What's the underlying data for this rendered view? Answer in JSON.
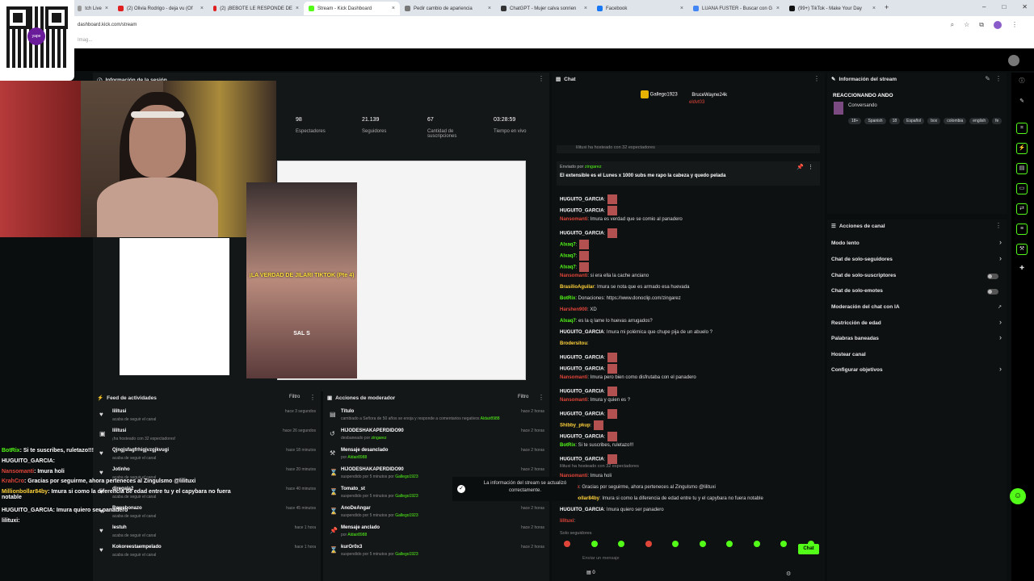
{
  "browser": {
    "tabs": [
      {
        "title": "tch Live",
        "icon_color": "#999999"
      },
      {
        "title": "(2) Olivia Rodrigo - deja vu (Of",
        "icon_color": "#e02020"
      },
      {
        "title": "(2) ¡BEBOTE LE RESPONDE DE",
        "icon_color": "#e02020"
      },
      {
        "title": "Stream - Kick Dashboard",
        "icon_color": "#53fc18"
      },
      {
        "title": "Pedir cambio de apariencia",
        "icon_color": "#777777"
      },
      {
        "title": "ChatGPT - Mujer calva sonrien",
        "icon_color": "#333333"
      },
      {
        "title": "Facebook",
        "icon_color": "#1877f2"
      },
      {
        "title": "LUANA FUSTER - Buscar con G",
        "icon_color": "#4285f4"
      },
      {
        "title": "(99+) TikTok - Make Your Day",
        "icon_color": "#111111"
      }
    ],
    "new_tab": "+",
    "window_controls": [
      "–",
      "□",
      "✕"
    ],
    "url": "dashboard.kick.com/stream",
    "bookmark_text": "Imag..."
  },
  "qr": {
    "logo_text": "yape"
  },
  "session": {
    "title": "Información de la sesión",
    "stats": [
      {
        "value": "98",
        "label": "Espectadores"
      },
      {
        "value": "21.139",
        "label": "Seguidores"
      },
      {
        "value": "67",
        "label": "Cantidad de suscripciones"
      },
      {
        "value": "03:28:59",
        "label": "Tiempo en vivo"
      }
    ]
  },
  "video": {
    "caption": "¡LA VERDAD DE JILARI TIKTOK (Pte 4)",
    "caption2": "SAL S"
  },
  "feed": {
    "title": "Feed de actividades",
    "filter": "Filtro",
    "rows": [
      {
        "icon": "heart-icon",
        "name": "lilitusi",
        "sub": "acaba de seguir el canal",
        "time": "hace 3 segundos"
      },
      {
        "icon": "host-icon",
        "name": "lilitusi",
        "sub": "¡ha hosteado con 32 espectadores!",
        "time": "hace 26 segundos"
      },
      {
        "icon": "heart-icon",
        "name": "Qjngjsfagfrhigjvzgjkvugi",
        "sub": "acaba de seguir el canal",
        "time": "hace 18 minutos"
      },
      {
        "icon": "heart-icon",
        "name": "Jotinho",
        "sub": "acaba de seguir el canal",
        "time": "hace 20 minutos"
      },
      {
        "icon": "heart-icon",
        "name": "djregala2",
        "sub": "acaba de seguir el canal",
        "time": "hace 40 minutos"
      },
      {
        "icon": "heart-icon",
        "name": "Rewebonazo",
        "sub": "acaba de seguir el canal",
        "time": "hace 45 minutos"
      },
      {
        "icon": "heart-icon",
        "name": "lestuh",
        "sub": "acaba de seguir el canal",
        "time": "hace 1 hora"
      },
      {
        "icon": "heart-icon",
        "name": "Kokoreestaempelado",
        "sub": "acaba de seguir el canal",
        "time": "hace 1 hora"
      }
    ]
  },
  "mods": {
    "title": "Acciones de moderador",
    "filter": "Filtro",
    "rows": [
      {
        "icon": "title-icon",
        "name": "Título",
        "sub": "cambiado a Señora de 50 años se enoja y responde a comentarios negativos",
        "by": "Aldair8988",
        "time": "hace 2 horas"
      },
      {
        "icon": "undo-icon",
        "name": "HIJODESHAKAPERDIDO90",
        "sub": "desbaneado por",
        "by": "zingarez",
        "time": "hace 2 horas"
      },
      {
        "icon": "hammer-icon",
        "name": "Mensaje desanclado",
        "sub": "por",
        "by": "Aldair8988",
        "time": "hace 2 horas"
      },
      {
        "icon": "timer-icon",
        "name": "HIJODESHAKAPERDIDO90",
        "sub": "suspendido por 5 minutos por",
        "by": "Gallego1923",
        "time": "hace 2 horas"
      },
      {
        "icon": "timer-icon",
        "name": "Tomato_st",
        "sub": "suspendido por 5 minutos por",
        "by": "Gallego1923",
        "time": "hace 2 horas"
      },
      {
        "icon": "timer-icon",
        "name": "AnoDeAngar",
        "sub": "suspendido por 5 minutos por",
        "by": "Gallego1923",
        "time": "hace 2 horas"
      },
      {
        "icon": "pin-icon",
        "name": "Mensaje anclado",
        "sub": "por",
        "by": "Aldair8988",
        "time": "hace 2 horas"
      },
      {
        "icon": "timer-icon",
        "name": "kurOr0x3",
        "sub": "suspendido por 5 minutos por",
        "by": "Gallego1923",
        "time": "hace 2 horas"
      }
    ]
  },
  "overlay_chat": [
    {
      "user": "BotRix",
      "msg": ": Si te suscribes, ruletazo!!!",
      "color": "#53fc18"
    },
    {
      "user": "HUGUITO_GARCIA",
      "msg": ":",
      "color": "#ffffff"
    },
    {
      "user": "Nansomanti",
      "msg": ": Imura holi",
      "color": "#e0453a"
    },
    {
      "user": "KrahCro",
      "msg": ": Gracias por seguirme, ahora perteneces al Zingulsmo @lilituxi",
      "color": "#e0453a"
    },
    {
      "user": "Millionbollar84by",
      "msg": ": Imura si como la diferencia de edad entre tu y el capybara no fuera notable",
      "color": "#ffd23a"
    },
    {
      "user": "HUGUITO_GARCIA",
      "msg": ": Imura quiero ser panadero",
      "color": "#ffffff"
    },
    {
      "user": "lilituxi",
      "msg": ":",
      "color": "#ffffff"
    }
  ],
  "chat": {
    "title": "Chat",
    "top_users": [
      {
        "name": "Gallego1923",
        "color": "#ffd23a"
      },
      {
        "name": "BruceWayne24k",
        "color": "#ffffff"
      },
      {
        "name": "eldvt03",
        "color": "#e0453a"
      }
    ],
    "banner": "lilituxi ha hosteado con 32 espectadores",
    "pinned_by_label": "Enviado por",
    "pinned_by": "zingarez",
    "pinned_msg": "El extensible es el Lunes x 1000 subs me rapo la cabeza y quedo pelada",
    "messages": [
      {
        "user": "HUGUITO_GARCIA",
        "text": ":",
        "color": "#ffffff",
        "emote": true
      },
      {
        "user": "HUGUITO_GARCIA",
        "text": ":",
        "color": "#ffffff",
        "emote": true
      },
      {
        "user": "Nansomanti",
        "text": ": Imura es verdad que se comio al panadero",
        "color": "#e0453a",
        "emote": false
      },
      {
        "user": "HUGUITO_GARCIA",
        "text": ":",
        "color": "#ffffff",
        "emote": true
      },
      {
        "user": "Alxaq7",
        "text": ":",
        "color": "#53fc18",
        "emote": true
      },
      {
        "user": "Alxaq7",
        "text": ":",
        "color": "#53fc18",
        "emote": true
      },
      {
        "user": "Alxaq7",
        "text": ":",
        "color": "#53fc18",
        "emote": true
      },
      {
        "user": "Nansomanti",
        "text": ": si era ella la cache anciano",
        "color": "#e0453a",
        "emote": false
      },
      {
        "user": "BrasilioAguilar",
        "text": ": Imura se nota que es armado esa huevada",
        "color": "#ffd23a",
        "emote": false
      },
      {
        "user": "BotRix",
        "text": ": Donaciones: https://www.donoclip.com/zingarez",
        "color": "#53fc18",
        "emote": false
      },
      {
        "user": "Harshen900",
        "text": ": XD",
        "color": "#e0453a",
        "emote": false
      },
      {
        "user": "Alxaq7",
        "text": ": es la q lame lo huevas arrugados?",
        "color": "#53fc18",
        "emote": false
      },
      {
        "user": "HUGUITO_GARCIA",
        "text": ": Imura mi polémica que chupe pija de un abuelo ?",
        "color": "#ffffff",
        "emote": false
      },
      {
        "user": "Brodersitou",
        "text": ":",
        "color": "#ffd23a",
        "emote": false
      },
      {
        "user": "HUGUITO_GARCIA",
        "text": ":",
        "color": "#ffffff",
        "emote": true
      },
      {
        "user": "HUGUITO_GARCIA",
        "text": ":",
        "color": "#ffffff",
        "emote": true
      },
      {
        "user": "Nansomanti",
        "text": ": Imura pero bien como disfrutaba con el panadero",
        "color": "#e0453a",
        "emote": false
      },
      {
        "user": "HUGUITO_GARCIA",
        "text": ":",
        "color": "#ffffff",
        "emote": true
      },
      {
        "user": "Nansomanti",
        "text": ": Imura y quien es ?",
        "color": "#e0453a",
        "emote": false
      },
      {
        "user": "HUGUITO_GARCIA",
        "text": ":",
        "color": "#ffffff",
        "emote": true
      },
      {
        "user": "Shibby_pkup",
        "text": ":",
        "color": "#ffd23a",
        "emote": true
      },
      {
        "user": "HUGUITO_GARCIA",
        "text": ":",
        "color": "#ffffff",
        "emote": true
      },
      {
        "user": "BotRix",
        "text": ": Si te suscribes, ruletazo!!!",
        "color": "#53fc18",
        "emote": false
      },
      {
        "user": "HUGUITO_GARCIA",
        "text": ":",
        "color": "#ffffff",
        "emote": true
      }
    ],
    "host_line": "lilituxi ha hosteado con 32 espectadores",
    "tail": [
      {
        "user": "Nansomanti",
        "text": ": Imura holi",
        "color": "#e0453a"
      },
      {
        "user": "KrahCro",
        "text": ": Gracias por seguirme, ahora perteneces al Zingulsmo @lilituxi",
        "color": "#e0453a"
      },
      {
        "user": "Millionbollar84by",
        "text": ": Imura si como la diferencia de edad entre tu y el capybara no fuera notable",
        "color": "#ffd23a"
      },
      {
        "user": "HUGUITO_GARCIA",
        "text": ": Imura quiero ser panadero",
        "color": "#ffffff"
      },
      {
        "user": "lilituxi",
        "text": ":",
        "color": "#e0453a"
      }
    ],
    "followers_only": "Solo seguidores",
    "input_placeholder": "Enviar un mensaje",
    "counter": "0",
    "send_label": "Chat"
  },
  "stream_info": {
    "title": "Información del stream",
    "stream_title": "REACCIONANDO ANDO",
    "category": "Conversando",
    "tags": [
      "18+",
      "Spanish",
      "18",
      "Español",
      "box",
      "colombia",
      "english",
      "fe"
    ]
  },
  "channel_actions": {
    "title": "Acciones de canal",
    "items": [
      {
        "label": "Modo lento",
        "control": "chevron"
      },
      {
        "label": "Chat de solo-seguidores",
        "control": "chevron"
      },
      {
        "label": "Chat de solo-suscriptores",
        "control": "toggle"
      },
      {
        "label": "Chat de solo-emotes",
        "control": "toggle"
      },
      {
        "label": "Moderación del chat con IA",
        "control": "external"
      },
      {
        "label": "Restricción de edad",
        "control": "chevron"
      },
      {
        "label": "Palabras baneadas",
        "control": "chevron"
      },
      {
        "label": "Hostear canal",
        "control": "none"
      },
      {
        "label": "Configurar objetivos",
        "control": "chevron"
      }
    ]
  },
  "toast": {
    "text": "La información del stream se actualizó correctamente."
  }
}
